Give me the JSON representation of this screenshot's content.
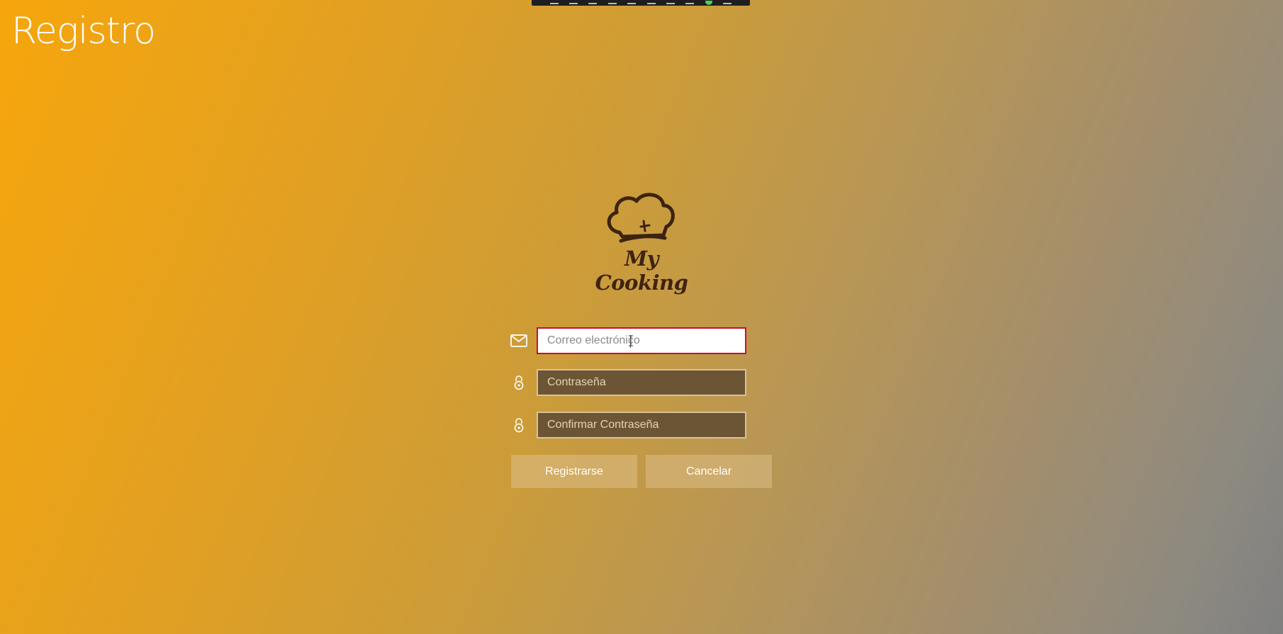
{
  "page": {
    "title": "Registro"
  },
  "logo": {
    "text": "My Cooking",
    "icon": "chef-hat-icon"
  },
  "form": {
    "email": {
      "icon": "mail-icon",
      "placeholder": "Correo electrónico",
      "value": ""
    },
    "password": {
      "icon": "lock-icon",
      "placeholder": "Contraseña",
      "value": ""
    },
    "confirm_password": {
      "icon": "lock-icon",
      "placeholder": "Confirmar Contraseña",
      "value": ""
    }
  },
  "buttons": {
    "register_label": "Registrarse",
    "cancel_label": "Cancelar"
  },
  "colors": {
    "focus_border": "#c8102e",
    "logo_brown": "#3d2310",
    "gradient_start": "#f6a60c",
    "gradient_end": "#808080"
  }
}
